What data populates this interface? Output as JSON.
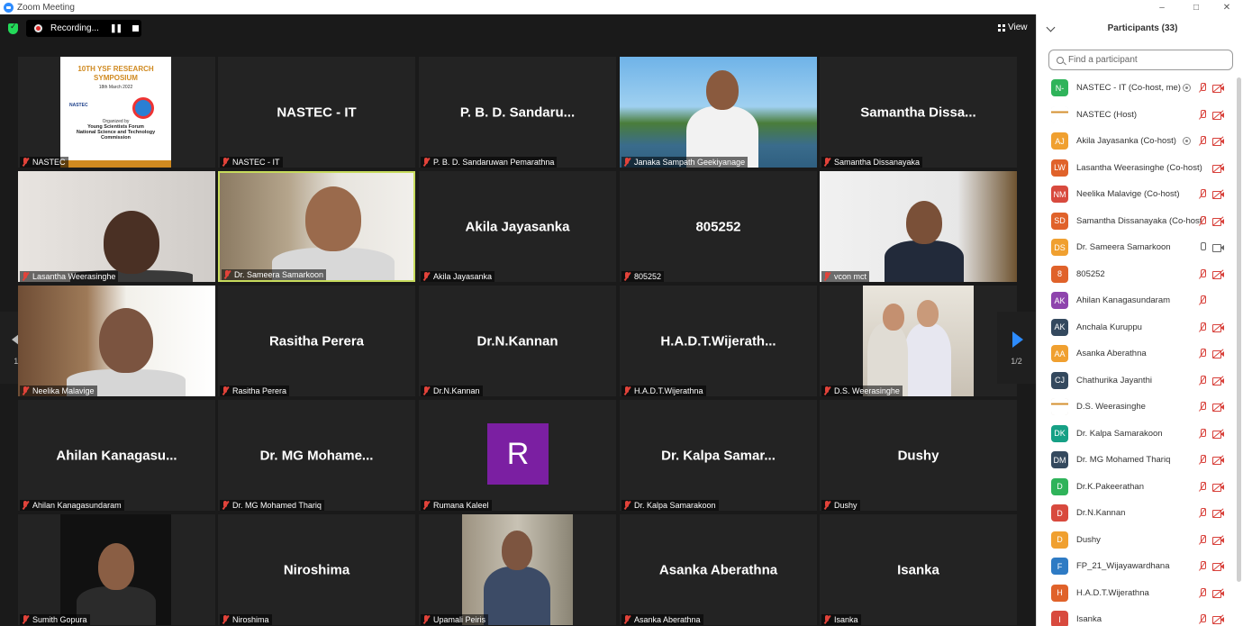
{
  "window": {
    "title": "Zoom Meeting",
    "controls": [
      "–",
      "□",
      "✕"
    ]
  },
  "toolbar": {
    "recording_label": "Recording...",
    "pause_glyph": "❚❚",
    "view_label": "View"
  },
  "pagination": {
    "left": "1/2",
    "right": "1/2"
  },
  "tiles": [
    {
      "label": "NASTEC",
      "kind": "poster",
      "poster": {
        "title": "10TH YSF RESEARCH SYMPOSIUM",
        "date": "18th March 2022",
        "logo_left": "NASTEC",
        "organized": "Organized by",
        "org_line1": "Young Scientists Forum",
        "org_line2": "National Science and Technology",
        "org_line3": "Commission"
      }
    },
    {
      "label": "NASTEC - IT",
      "kind": "name",
      "big": "NASTEC - IT"
    },
    {
      "label": "P. B. D. Sandaruwan Pemarathna",
      "kind": "name",
      "big": "P. B. D. Sandaru..."
    },
    {
      "label": "Janaka Sampath Geekiyanage",
      "kind": "video"
    },
    {
      "label": "Samantha Dissanayaka",
      "kind": "name",
      "big": "Samantha Dissa..."
    },
    {
      "label": "Lasantha Weerasinghe",
      "kind": "video"
    },
    {
      "label": "Dr. Sameera Samarkoon",
      "kind": "video"
    },
    {
      "label": "Akila Jayasanka",
      "kind": "name",
      "big": "Akila Jayasanka"
    },
    {
      "label": "805252",
      "kind": "name",
      "big": "805252"
    },
    {
      "label": "vcon mct",
      "kind": "video"
    },
    {
      "label": "Neelika Malavige",
      "kind": "video"
    },
    {
      "label": "Rasitha Perera",
      "kind": "name",
      "big": "Rasitha Perera"
    },
    {
      "label": "Dr.N.Kannan",
      "kind": "name",
      "big": "Dr.N.Kannan"
    },
    {
      "label": "H.A.D.T.Wijerathna",
      "kind": "name",
      "big": "H.A.D.T.Wijerath..."
    },
    {
      "label": "D.S. Weerasinghe",
      "kind": "video"
    },
    {
      "label": "Ahilan Kanagasundaram",
      "kind": "name",
      "big": "Ahilan  Kanagasu..."
    },
    {
      "label": "Dr. MG Mohamed Thariq",
      "kind": "name",
      "big": "Dr. MG  Mohame..."
    },
    {
      "label": "Rumana Kaleel",
      "kind": "avatar",
      "letter": "R",
      "color": "#7b1fa2"
    },
    {
      "label": "Dr. Kalpa Samarakoon",
      "kind": "name",
      "big": "Dr. Kalpa  Samar..."
    },
    {
      "label": "Dushy",
      "kind": "name",
      "big": "Dushy"
    },
    {
      "label": "Sumith Gopura",
      "kind": "video"
    },
    {
      "label": "Niroshima",
      "kind": "name",
      "big": "Niroshima"
    },
    {
      "label": "Upamali Peiris",
      "kind": "video"
    },
    {
      "label": "Asanka Aberathna",
      "kind": "name",
      "big": "Asanka Aberathna"
    },
    {
      "label": "Isanka",
      "kind": "name",
      "big": "Isanka"
    }
  ],
  "panel": {
    "title": "Participants (33)",
    "search_placeholder": "Find a participant",
    "participants": [
      {
        "initials": "N-",
        "color": "#2fb35a",
        "name": "NASTEC - IT (Co-host, me)",
        "rec": true,
        "mic": "off",
        "cam": "off"
      },
      {
        "initials": "",
        "color": "#eeeeee",
        "name": "NASTEC (Host)",
        "rec": false,
        "mic": "off",
        "cam": "off",
        "img": true
      },
      {
        "initials": "AJ",
        "color": "#f0a030",
        "name": "Akila Jayasanka (Co-host)",
        "rec": true,
        "mic": "off",
        "cam": "off"
      },
      {
        "initials": "LW",
        "color": "#e0622a",
        "name": "Lasantha Weerasinghe (Co-host)",
        "rec": false,
        "mic": "none",
        "cam": "off"
      },
      {
        "initials": "NM",
        "color": "#d84a3e",
        "name": "Neelika Malavige (Co-host)",
        "rec": false,
        "mic": "off",
        "cam": "off"
      },
      {
        "initials": "SD",
        "color": "#e0622a",
        "name": "Samantha Dissanayaka (Co-host)",
        "rec": false,
        "mic": "off",
        "cam": "off"
      },
      {
        "initials": "DS",
        "color": "#f0a030",
        "name": "Dr. Sameera Samarkoon",
        "rec": false,
        "mic": "on",
        "cam": "on"
      },
      {
        "initials": "8",
        "color": "#e0622a",
        "name": "805252",
        "rec": false,
        "mic": "off",
        "cam": "off"
      },
      {
        "initials": "AK",
        "color": "#8e44ad",
        "name": "Ahilan Kanagasundaram",
        "rec": false,
        "mic": "off",
        "cam": "none"
      },
      {
        "initials": "AK",
        "color": "#34495e",
        "name": "Anchala Kuruppu",
        "rec": false,
        "mic": "off",
        "cam": "off"
      },
      {
        "initials": "AA",
        "color": "#f0a030",
        "name": "Asanka Aberathna",
        "rec": false,
        "mic": "off",
        "cam": "off"
      },
      {
        "initials": "CJ",
        "color": "#34495e",
        "name": "Chathurika Jayanthi",
        "rec": false,
        "mic": "off",
        "cam": "off"
      },
      {
        "initials": "",
        "color": "#d9c7b8",
        "name": "D.S. Weerasinghe",
        "rec": false,
        "mic": "off",
        "cam": "off",
        "img": true
      },
      {
        "initials": "DK",
        "color": "#16a085",
        "name": "Dr. Kalpa Samarakoon",
        "rec": false,
        "mic": "off",
        "cam": "off"
      },
      {
        "initials": "DM",
        "color": "#34495e",
        "name": "Dr. MG Mohamed Thariq",
        "rec": false,
        "mic": "off",
        "cam": "off"
      },
      {
        "initials": "D",
        "color": "#2fb35a",
        "name": "Dr.K.Pakeerathan",
        "rec": false,
        "mic": "off",
        "cam": "off"
      },
      {
        "initials": "D",
        "color": "#d84a3e",
        "name": "Dr.N.Kannan",
        "rec": false,
        "mic": "off",
        "cam": "off"
      },
      {
        "initials": "D",
        "color": "#f0a030",
        "name": "Dushy",
        "rec": false,
        "mic": "off",
        "cam": "off"
      },
      {
        "initials": "F",
        "color": "#2e7bc4",
        "name": "FP_21_Wijayawardhana",
        "rec": false,
        "mic": "off",
        "cam": "off"
      },
      {
        "initials": "H",
        "color": "#e0622a",
        "name": "H.A.D.T.Wijerathna",
        "rec": false,
        "mic": "off",
        "cam": "off"
      },
      {
        "initials": "I",
        "color": "#d84a3e",
        "name": "Isanka",
        "rec": false,
        "mic": "off",
        "cam": "off"
      }
    ]
  }
}
